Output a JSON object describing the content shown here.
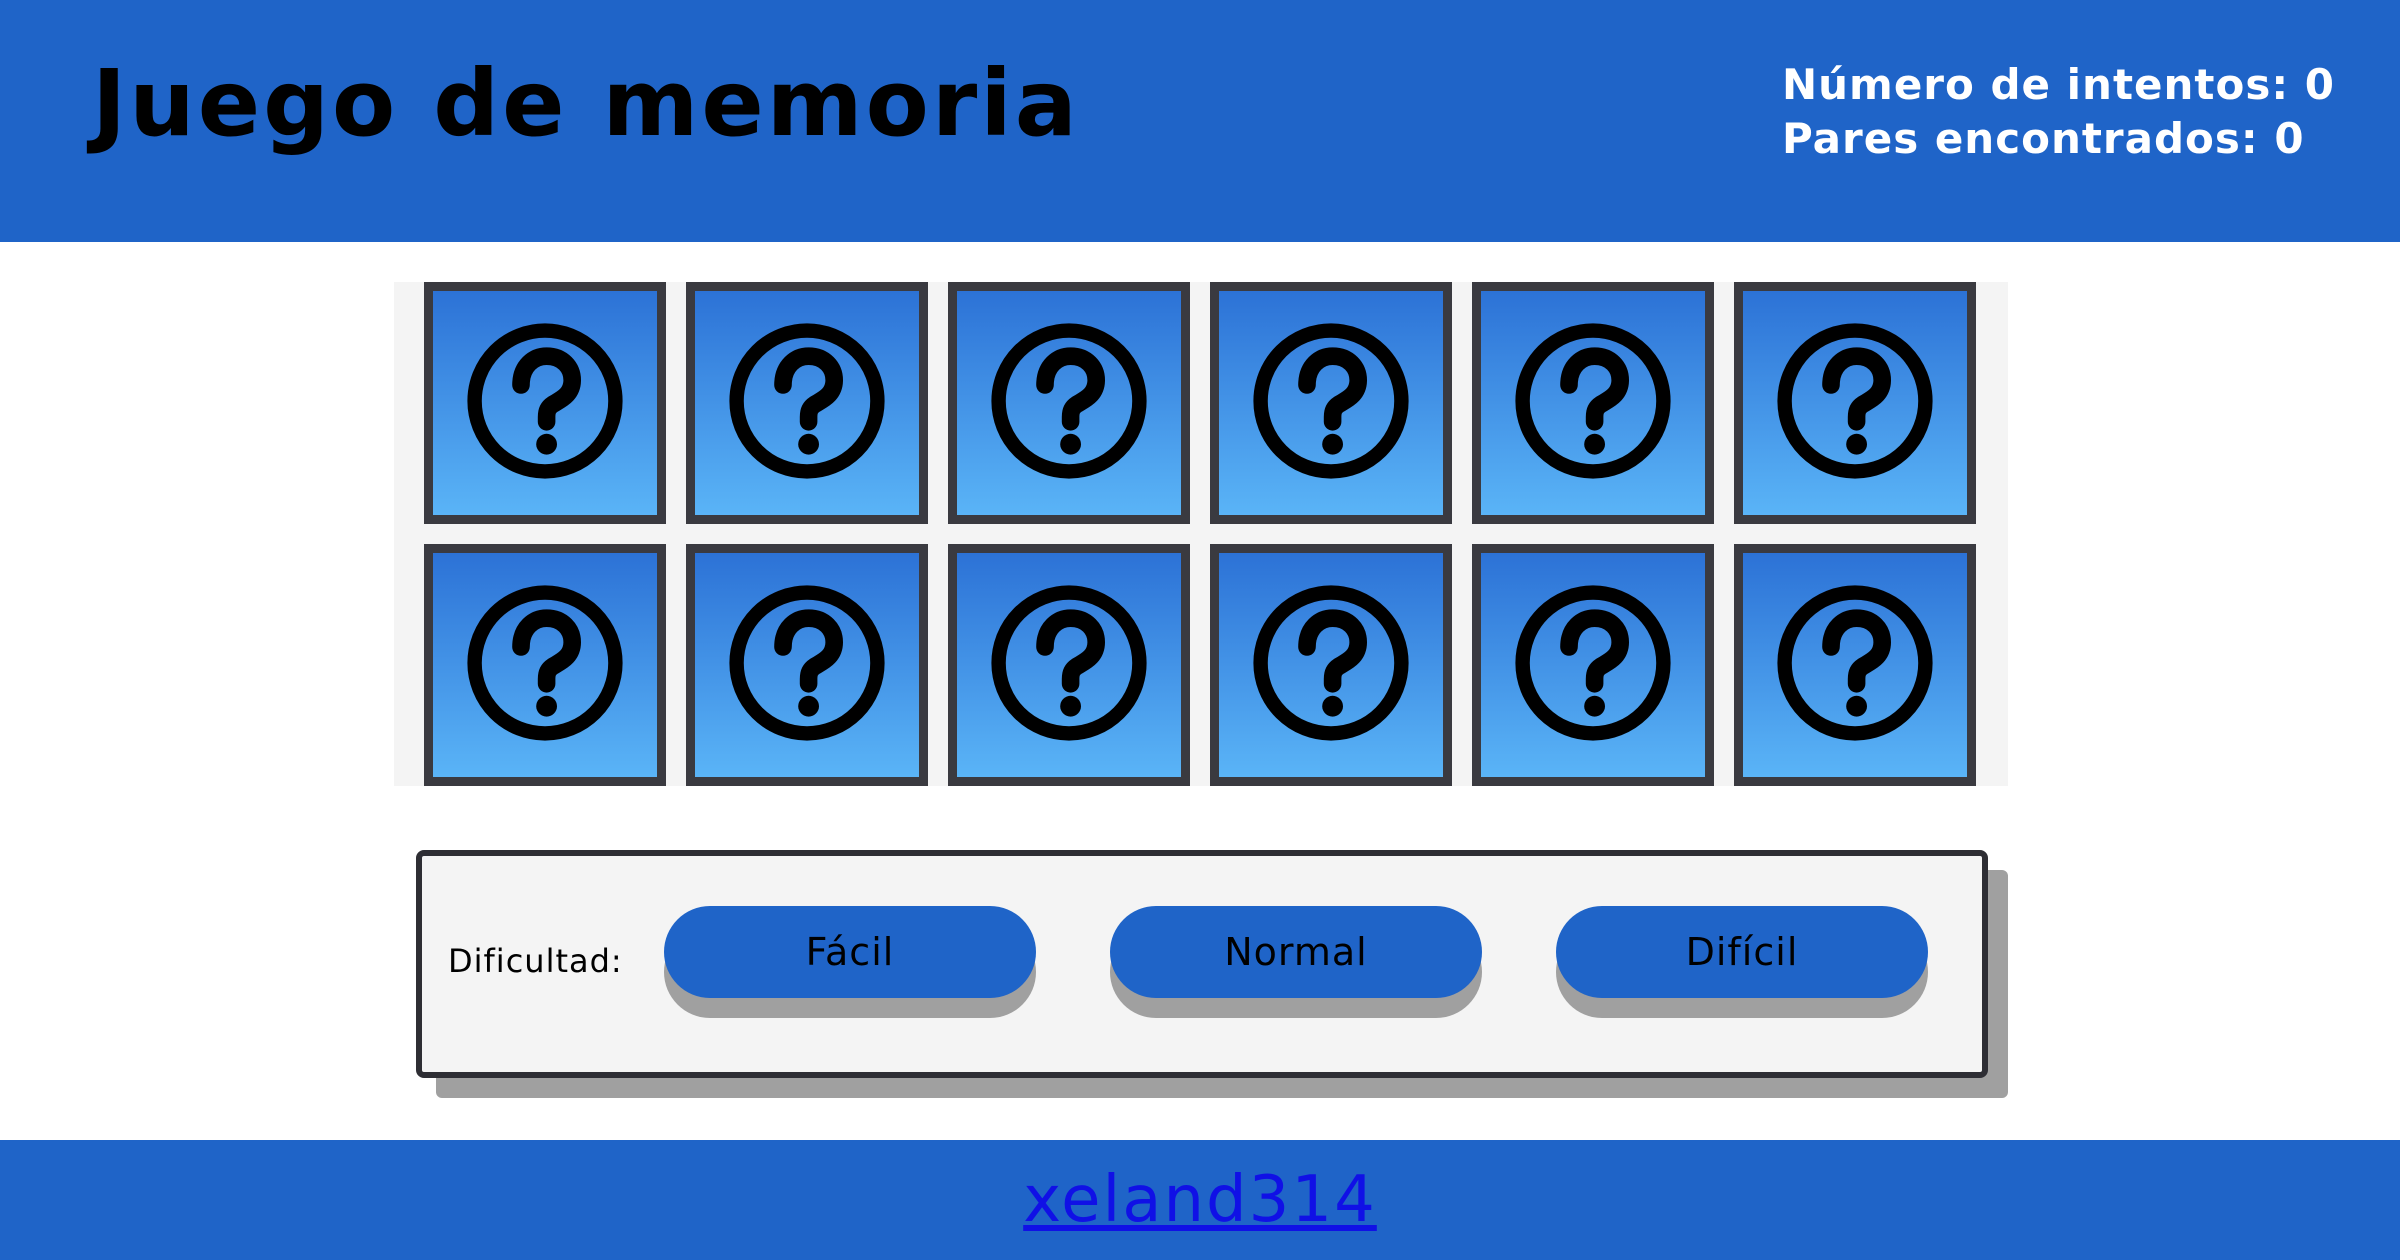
{
  "header": {
    "title": "Juego de memoria",
    "attempts_text": "Número de intentos: 0",
    "pairs_text": "Pares encontrados: 0"
  },
  "board": {
    "rows": 2,
    "columns": 6,
    "card_icon": "question-circle-icon",
    "card_state": "face-down"
  },
  "difficulty": {
    "label": "Dificultad:",
    "buttons": [
      "Fácil",
      "Normal",
      "Difícil"
    ]
  },
  "footer": {
    "link_text": "xeland314"
  },
  "colors": {
    "primary": "#1f64c8",
    "card_top": "#2c72d6",
    "card_bottom": "#5ab4f7",
    "card_border": "#3a3a40",
    "link": "#1010e6"
  }
}
